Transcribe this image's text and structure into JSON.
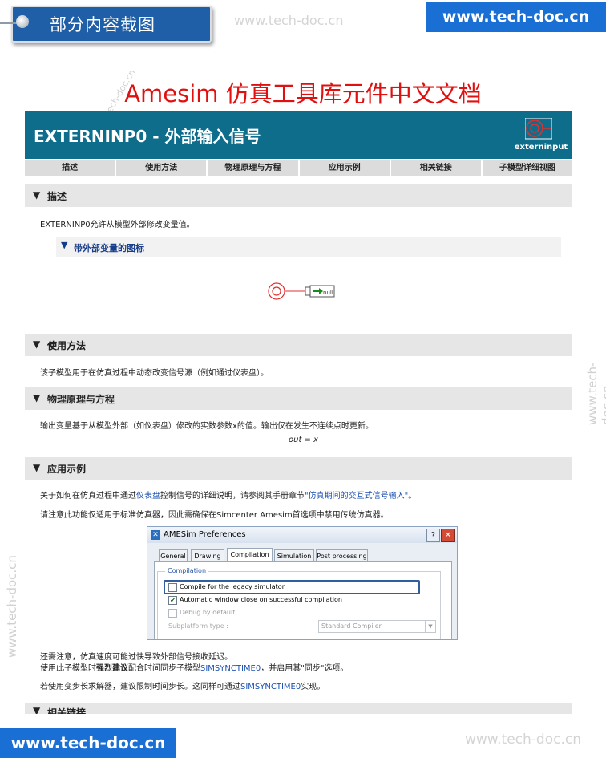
{
  "banner": {
    "tab_label": "部分内容截图",
    "watermark_top": "www.tech-doc.cn",
    "site_top": "www.tech-doc.cn",
    "site_bottom": "www.tech-doc.cn",
    "watermark_bottom": "www.tech-doc.cn",
    "watermark_vertical": "www.tech-doc.cn",
    "watermark_diag": "tech-doc.cn"
  },
  "main_title": "Amesim 仿真工具库元件中文文档",
  "doc": {
    "title": "EXTERNINP0 - 外部输入信号",
    "icon_label": "externinput",
    "tabs": [
      "描述",
      "使用方法",
      "物理原理与方程",
      "应用示例",
      "相关链接",
      "子模型详细视图"
    ],
    "sections": {
      "desc": {
        "title": "描述",
        "text": "EXTERNINP0允许从模型外部修改变量值。"
      },
      "sub": {
        "title": "带外部变量的图标"
      },
      "icon_null_label": "null",
      "usage": {
        "title": "使用方法",
        "text": "该子模型用于在仿真过程中动态改变信号源（例如通过仪表盘）。"
      },
      "physics": {
        "title": "物理原理与方程",
        "text": "输出变量基于从模型外部（如仪表盘）修改的实数参数x的值。输出仅在发生不连续点时更新。",
        "equation": "out = x"
      },
      "examples": {
        "title": "应用示例",
        "p1_a": "关于如何在仿真过程中通过",
        "p1_link1": "仪表盘",
        "p1_b": "控制信号的详细说明，请参阅其手册章节",
        "p1_link2": "\"仿真期间的交互式信号输入\"",
        "p1_c": "。",
        "p2": "请注意此功能仅适用于标准仿真器，因此需确保在Simcenter Amesim首选项中禁用传统仿真器。",
        "p3": "还需注意，仿真速度可能过快导致外部信号接收延迟。",
        "p4_a": "使用此子模型时",
        "p4_bold": "强烈建议",
        "p4_b": "配合时间同步子模型",
        "p4_link": "SIMSYNCTIME0",
        "p4_c": "，并启用其\"同步\"选项。",
        "p5_a": "若使用变步长求解器，建议限制时间步长。这同样可通过",
        "p5_link": "SIMSYNCTIME0",
        "p5_b": "实现。"
      },
      "links": {
        "title": "相关链接"
      }
    }
  },
  "dialog": {
    "title": "AMESim Preferences",
    "help": "?",
    "close": "✕",
    "tabs": [
      "General",
      "Drawing",
      "Compilation",
      "Simulation",
      "Post processing"
    ],
    "active_tab": "Compilation",
    "group_label": "Compilation",
    "options": [
      {
        "label": "Compile for the legacy simulator",
        "checked": false
      },
      {
        "label": "Automatic window close on successful compilation",
        "checked": true
      },
      {
        "label": "Debug by default",
        "checked": false
      }
    ],
    "subplatform_label": "Subplatform type :",
    "subplatform_value": "Standard Compiler"
  },
  "colors": {
    "header": "#0e6d8a",
    "title_red": "#e01010",
    "site_blue": "#1a6fd4",
    "link": "#1a4fb0"
  }
}
